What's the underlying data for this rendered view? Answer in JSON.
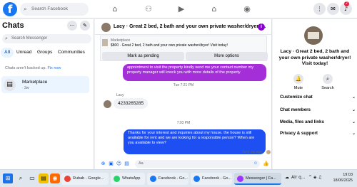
{
  "header": {
    "search_placeholder": "Search Facebook",
    "notification_badge": "2"
  },
  "sidebar": {
    "title": "Chats",
    "search_placeholder": "Search Messenger",
    "filters": [
      "All",
      "Unread",
      "Groups",
      "Communities"
    ],
    "backup_text": "Chats aren't backed up.",
    "backup_link": "Fix now",
    "conversation": {
      "name": "Marketplace",
      "sub": "· 3w"
    }
  },
  "chat": {
    "title": "Lacy · Great 2 bed, 2 bath and your own private washer/dryer! ...",
    "marketplace_label": "Marketplace",
    "listing": "$800 · Great 2 bed, 2 bath and your own private washer/dryer! Visit today!",
    "mark_pending": "Mark as pending",
    "more_options": "More options",
    "msg_out_1": "appointment to visit the property kindly send me your contact number my property manager will knock you with more details of the property",
    "ts_1": "Tue 7:21 PM",
    "sender_label": "Lacy",
    "msg_in": "4233265285",
    "ts_2": "7:03 PM",
    "msg_out_2": "Thanks for your interest and inquiries about my house. the house is still available for rent and we are looking for a responsible person? When are you available to view?",
    "sent_status": "Sent 1w ago",
    "composer_placeholder": "Aa"
  },
  "info": {
    "title": "Lacy · Great 2 bed, 2 bath and your own private washer/dryer! Visit today!",
    "mute": "Mute",
    "search": "Search",
    "rows": [
      "Customize chat",
      "Chat members",
      "Media, files and links",
      "Privacy & support"
    ]
  },
  "taskbar": {
    "tasks": [
      "Rubab - Google...",
      "WhatsApp",
      "Facebook - Go...",
      "Facebook - Go...",
      "Messenger | Fa..."
    ],
    "weather": "Air q...",
    "time": "19:03",
    "date": "18/06/2025"
  },
  "colors": {
    "brand": "#1877f2",
    "purple_bubble": "#a42ed8",
    "blue_bubble": "#1d4ff2",
    "info_icon": "#8b00d6"
  }
}
